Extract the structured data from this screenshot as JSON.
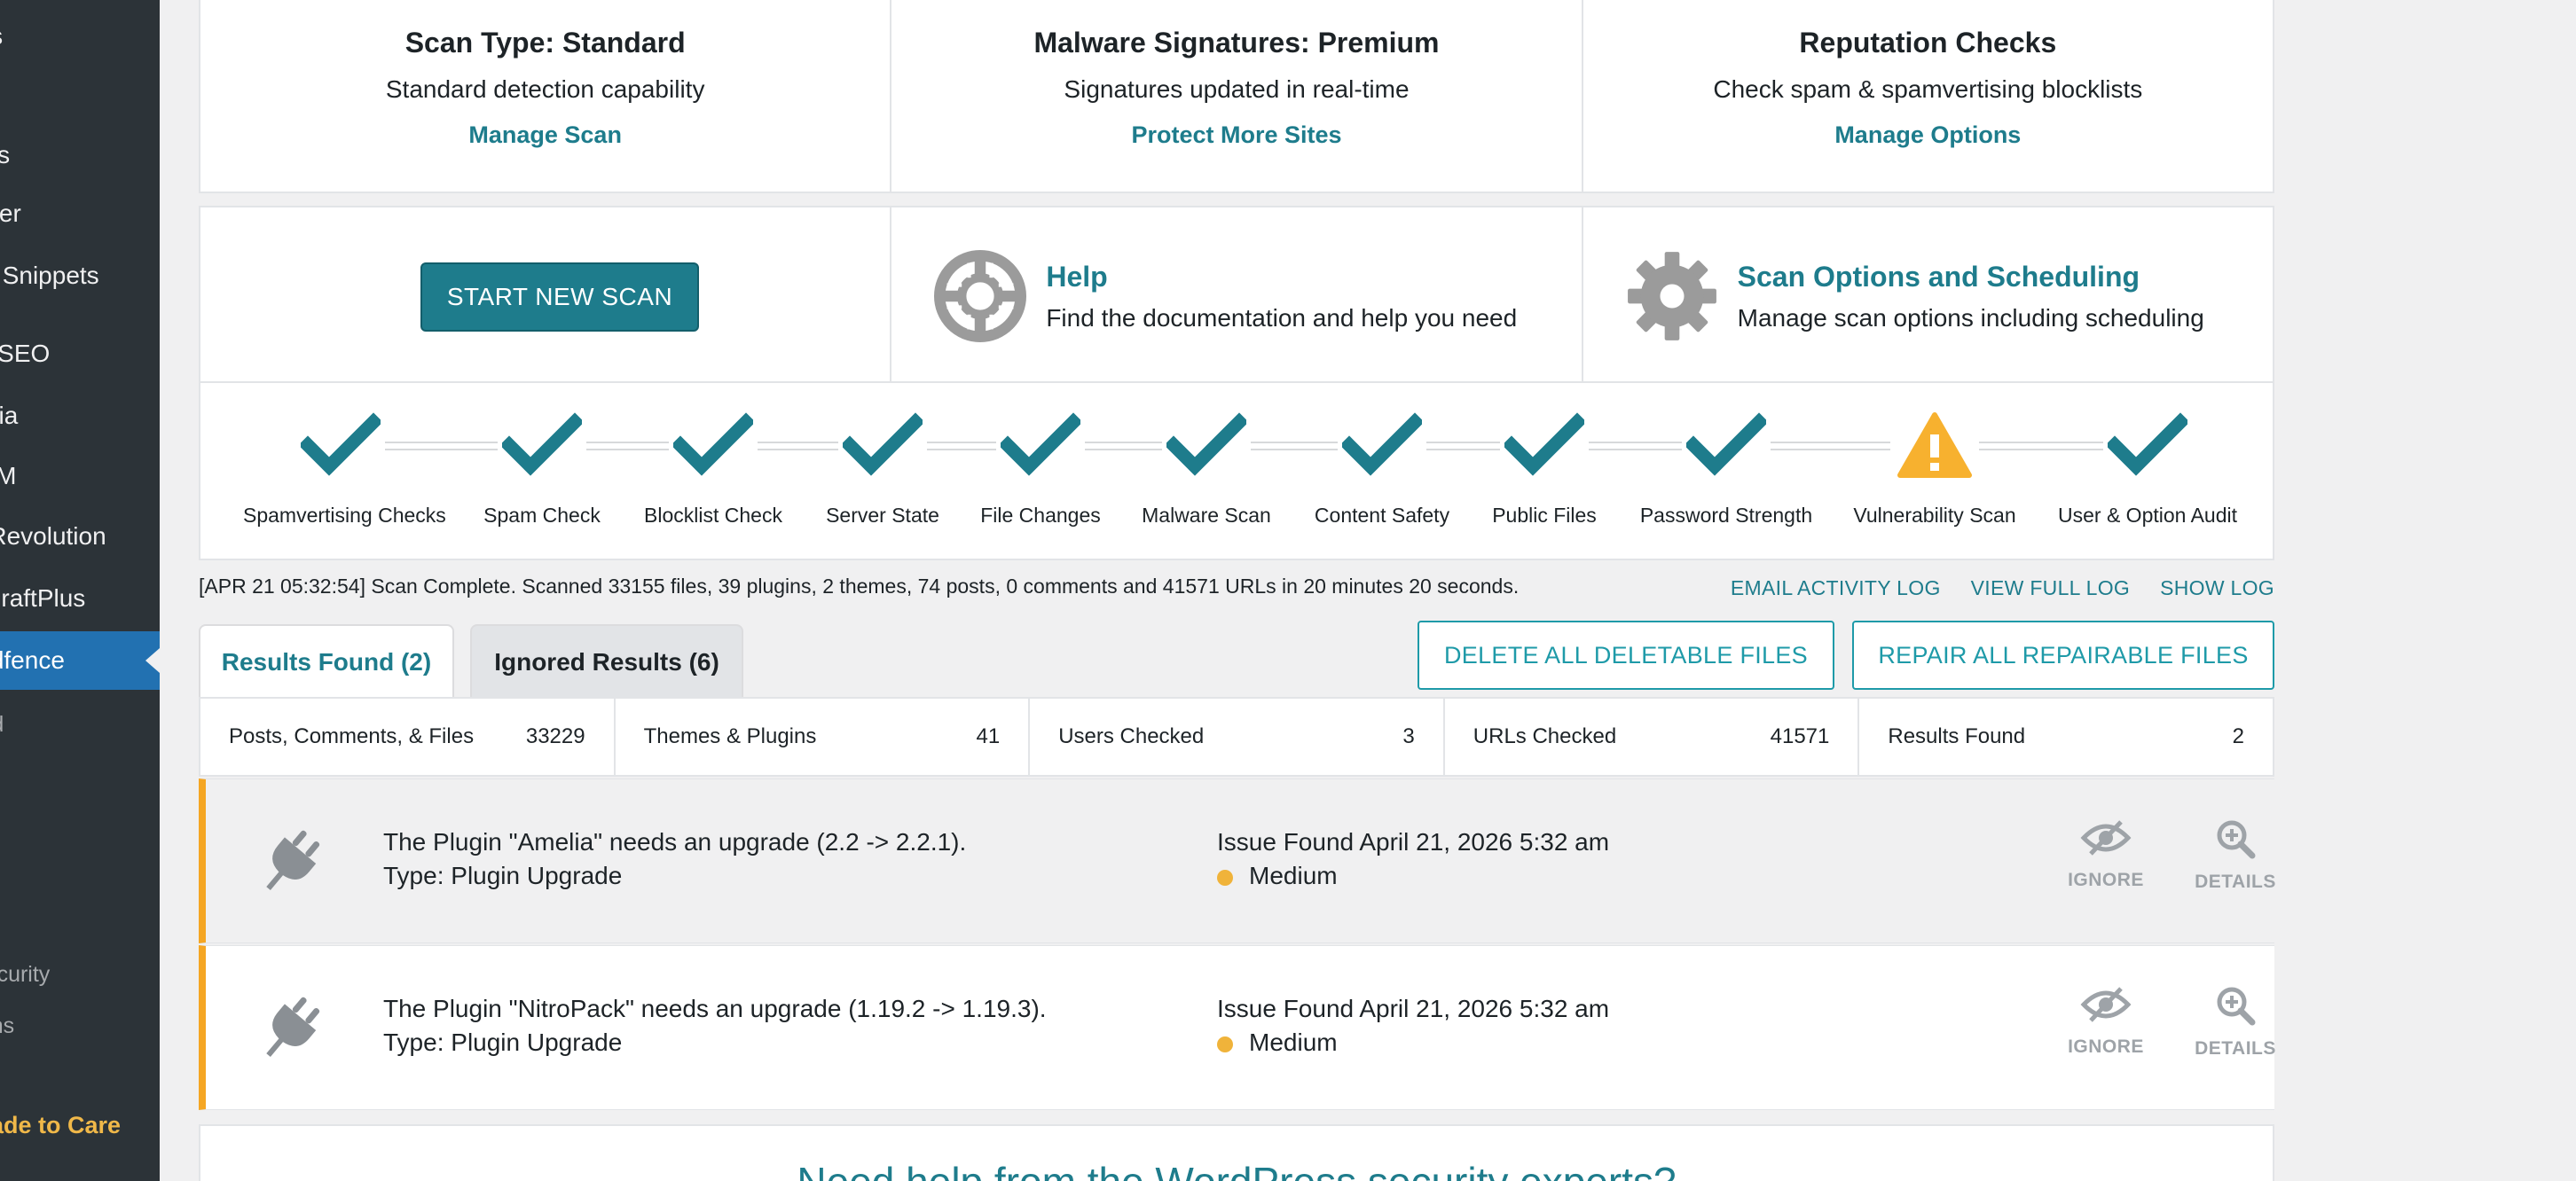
{
  "sidebar": {
    "items": [
      {
        "label": "Settings",
        "top": 0
      },
      {
        "label": "Settings"
      },
      {
        "label": "Optimizer"
      },
      {
        "label": "Code Snippets"
      },
      {
        "label": "Rank SEO"
      },
      {
        "label": "Media"
      },
      {
        "label": "WPM"
      },
      {
        "label": "Slider Revolution"
      },
      {
        "label": "UpdraftPlus"
      },
      {
        "label": "Wordfence"
      },
      {
        "label": "Dashboard"
      },
      {
        "label": "Security"
      },
      {
        "label": "Options"
      },
      {
        "label": "Upgrade to Care"
      }
    ]
  },
  "features": [
    {
      "title": "Scan Type: Standard",
      "desc": "Standard detection capability",
      "link": "Manage Scan"
    },
    {
      "title": "Malware Signatures: Premium",
      "desc": "Signatures updated in real-time",
      "link": "Protect More Sites"
    },
    {
      "title": "Reputation Checks",
      "desc": "Check spam & spamvertising blocklists",
      "link": "Manage Options"
    }
  ],
  "actions": {
    "start_scan": "START NEW SCAN",
    "help_title": "Help",
    "help_desc": "Find the documentation and help you need",
    "options_title": "Scan Options and Scheduling",
    "options_desc": "Manage scan options including scheduling"
  },
  "stages": [
    {
      "label": "Spamvertising Checks",
      "status": "complete"
    },
    {
      "label": "Spam Check",
      "status": "complete"
    },
    {
      "label": "Blocklist Check",
      "status": "complete"
    },
    {
      "label": "Server State",
      "status": "complete"
    },
    {
      "label": "File Changes",
      "status": "complete"
    },
    {
      "label": "Malware Scan",
      "status": "complete"
    },
    {
      "label": "Content Safety",
      "status": "complete"
    },
    {
      "label": "Public Files",
      "status": "complete"
    },
    {
      "label": "Password Strength",
      "status": "complete"
    },
    {
      "label": "Vulnerability Scan",
      "status": "warning"
    },
    {
      "label": "User & Option Audit",
      "status": "complete"
    }
  ],
  "scan_status": "[APR 21 05:32:54] Scan Complete. Scanned 33155 files, 39 plugins, 2 themes, 74 posts, 0 comments and 41571 URLs in 20 minutes 20 seconds.",
  "log_links": {
    "email": "EMAIL ACTIVITY LOG",
    "full": "VIEW FULL LOG",
    "show": "SHOW LOG"
  },
  "tabs": {
    "results": "Results Found (2)",
    "ignored": "Ignored Results (6)"
  },
  "bulk_actions": {
    "delete": "DELETE ALL DELETABLE FILES",
    "repair": "REPAIR ALL REPAIRABLE FILES"
  },
  "stats": [
    {
      "label": "Posts, Comments, & Files",
      "value": "33229"
    },
    {
      "label": "Themes & Plugins",
      "value": "41"
    },
    {
      "label": "Users Checked",
      "value": "3"
    },
    {
      "label": "URLs Checked",
      "value": "41571"
    },
    {
      "label": "Results Found",
      "value": "2"
    }
  ],
  "issues": [
    {
      "summary": "The Plugin \"Amelia\" needs an upgrade (2.2 -> 2.2.1).",
      "type": "Type: Plugin Upgrade",
      "found": "Issue Found April 21, 2026 5:32 am",
      "severity": "Medium",
      "ignore": "IGNORE",
      "details": "DETAILS"
    },
    {
      "summary": "The Plugin \"NitroPack\" needs an upgrade (1.19.2 -> 1.19.3).",
      "type": "Type: Plugin Upgrade",
      "found": "Issue Found April 21, 2026 5:32 am",
      "severity": "Medium",
      "ignore": "IGNORE",
      "details": "DETAILS"
    }
  ],
  "help_banner": "Need help from the WordPress security experts?",
  "colors": {
    "accent": "#1e7c8c",
    "warning": "#f5a623",
    "sidebar": "#2c3338",
    "active": "#2271b1"
  }
}
